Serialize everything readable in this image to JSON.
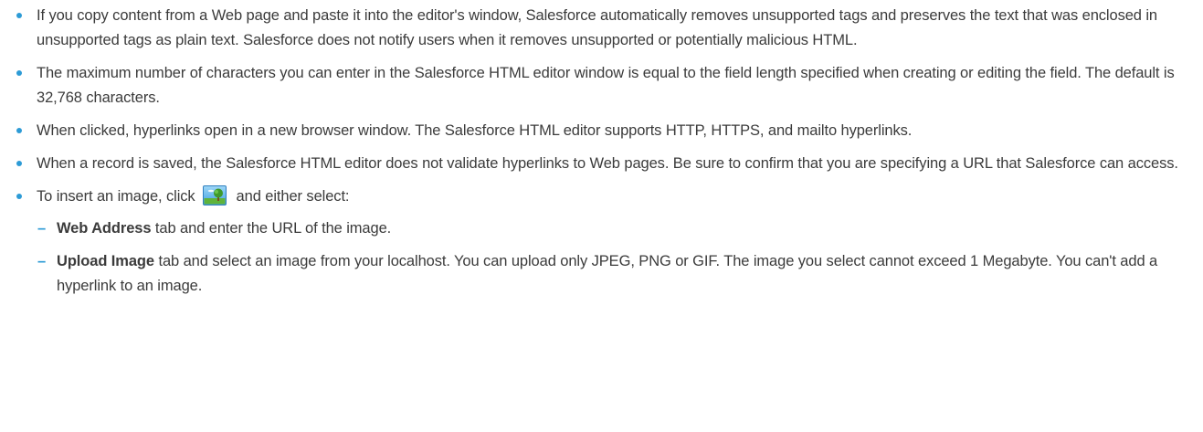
{
  "bullets": [
    {
      "text": "If you copy content from a Web page and paste it into the editor's window, Salesforce automatically removes unsupported tags and preserves the text that was enclosed in unsupported tags as plain text. Salesforce does not notify users when it removes unsupported or potentially malicious HTML."
    },
    {
      "text": "The maximum number of characters you can enter in the Salesforce HTML editor window is equal to the field length specified when creating or editing the field. The default is 32,768 characters."
    },
    {
      "text": "When clicked, hyperlinks open in a new browser window. The Salesforce HTML editor supports HTTP, HTTPS, and mailto hyperlinks."
    },
    {
      "text": "When a record is saved, the Salesforce HTML editor does not validate hyperlinks to Web pages. Be sure to confirm that you are specifying a URL that Salesforce can access."
    },
    {
      "text_before_icon": "To insert an image, click",
      "icon": "insert-image-icon",
      "text_after_icon": "and either select:",
      "subitems": [
        {
          "bold": "Web Address",
          "text": " tab and enter the URL of the image."
        },
        {
          "bold": "Upload Image",
          "text": " tab and select an image from your localhost. You can upload only JPEG, PNG or GIF. The image you select cannot exceed 1 Megabyte. You can't add a hyperlink to an image."
        }
      ]
    }
  ],
  "colors": {
    "text": "#3b3b3b",
    "bullet_accent": "#2d9bd6"
  }
}
